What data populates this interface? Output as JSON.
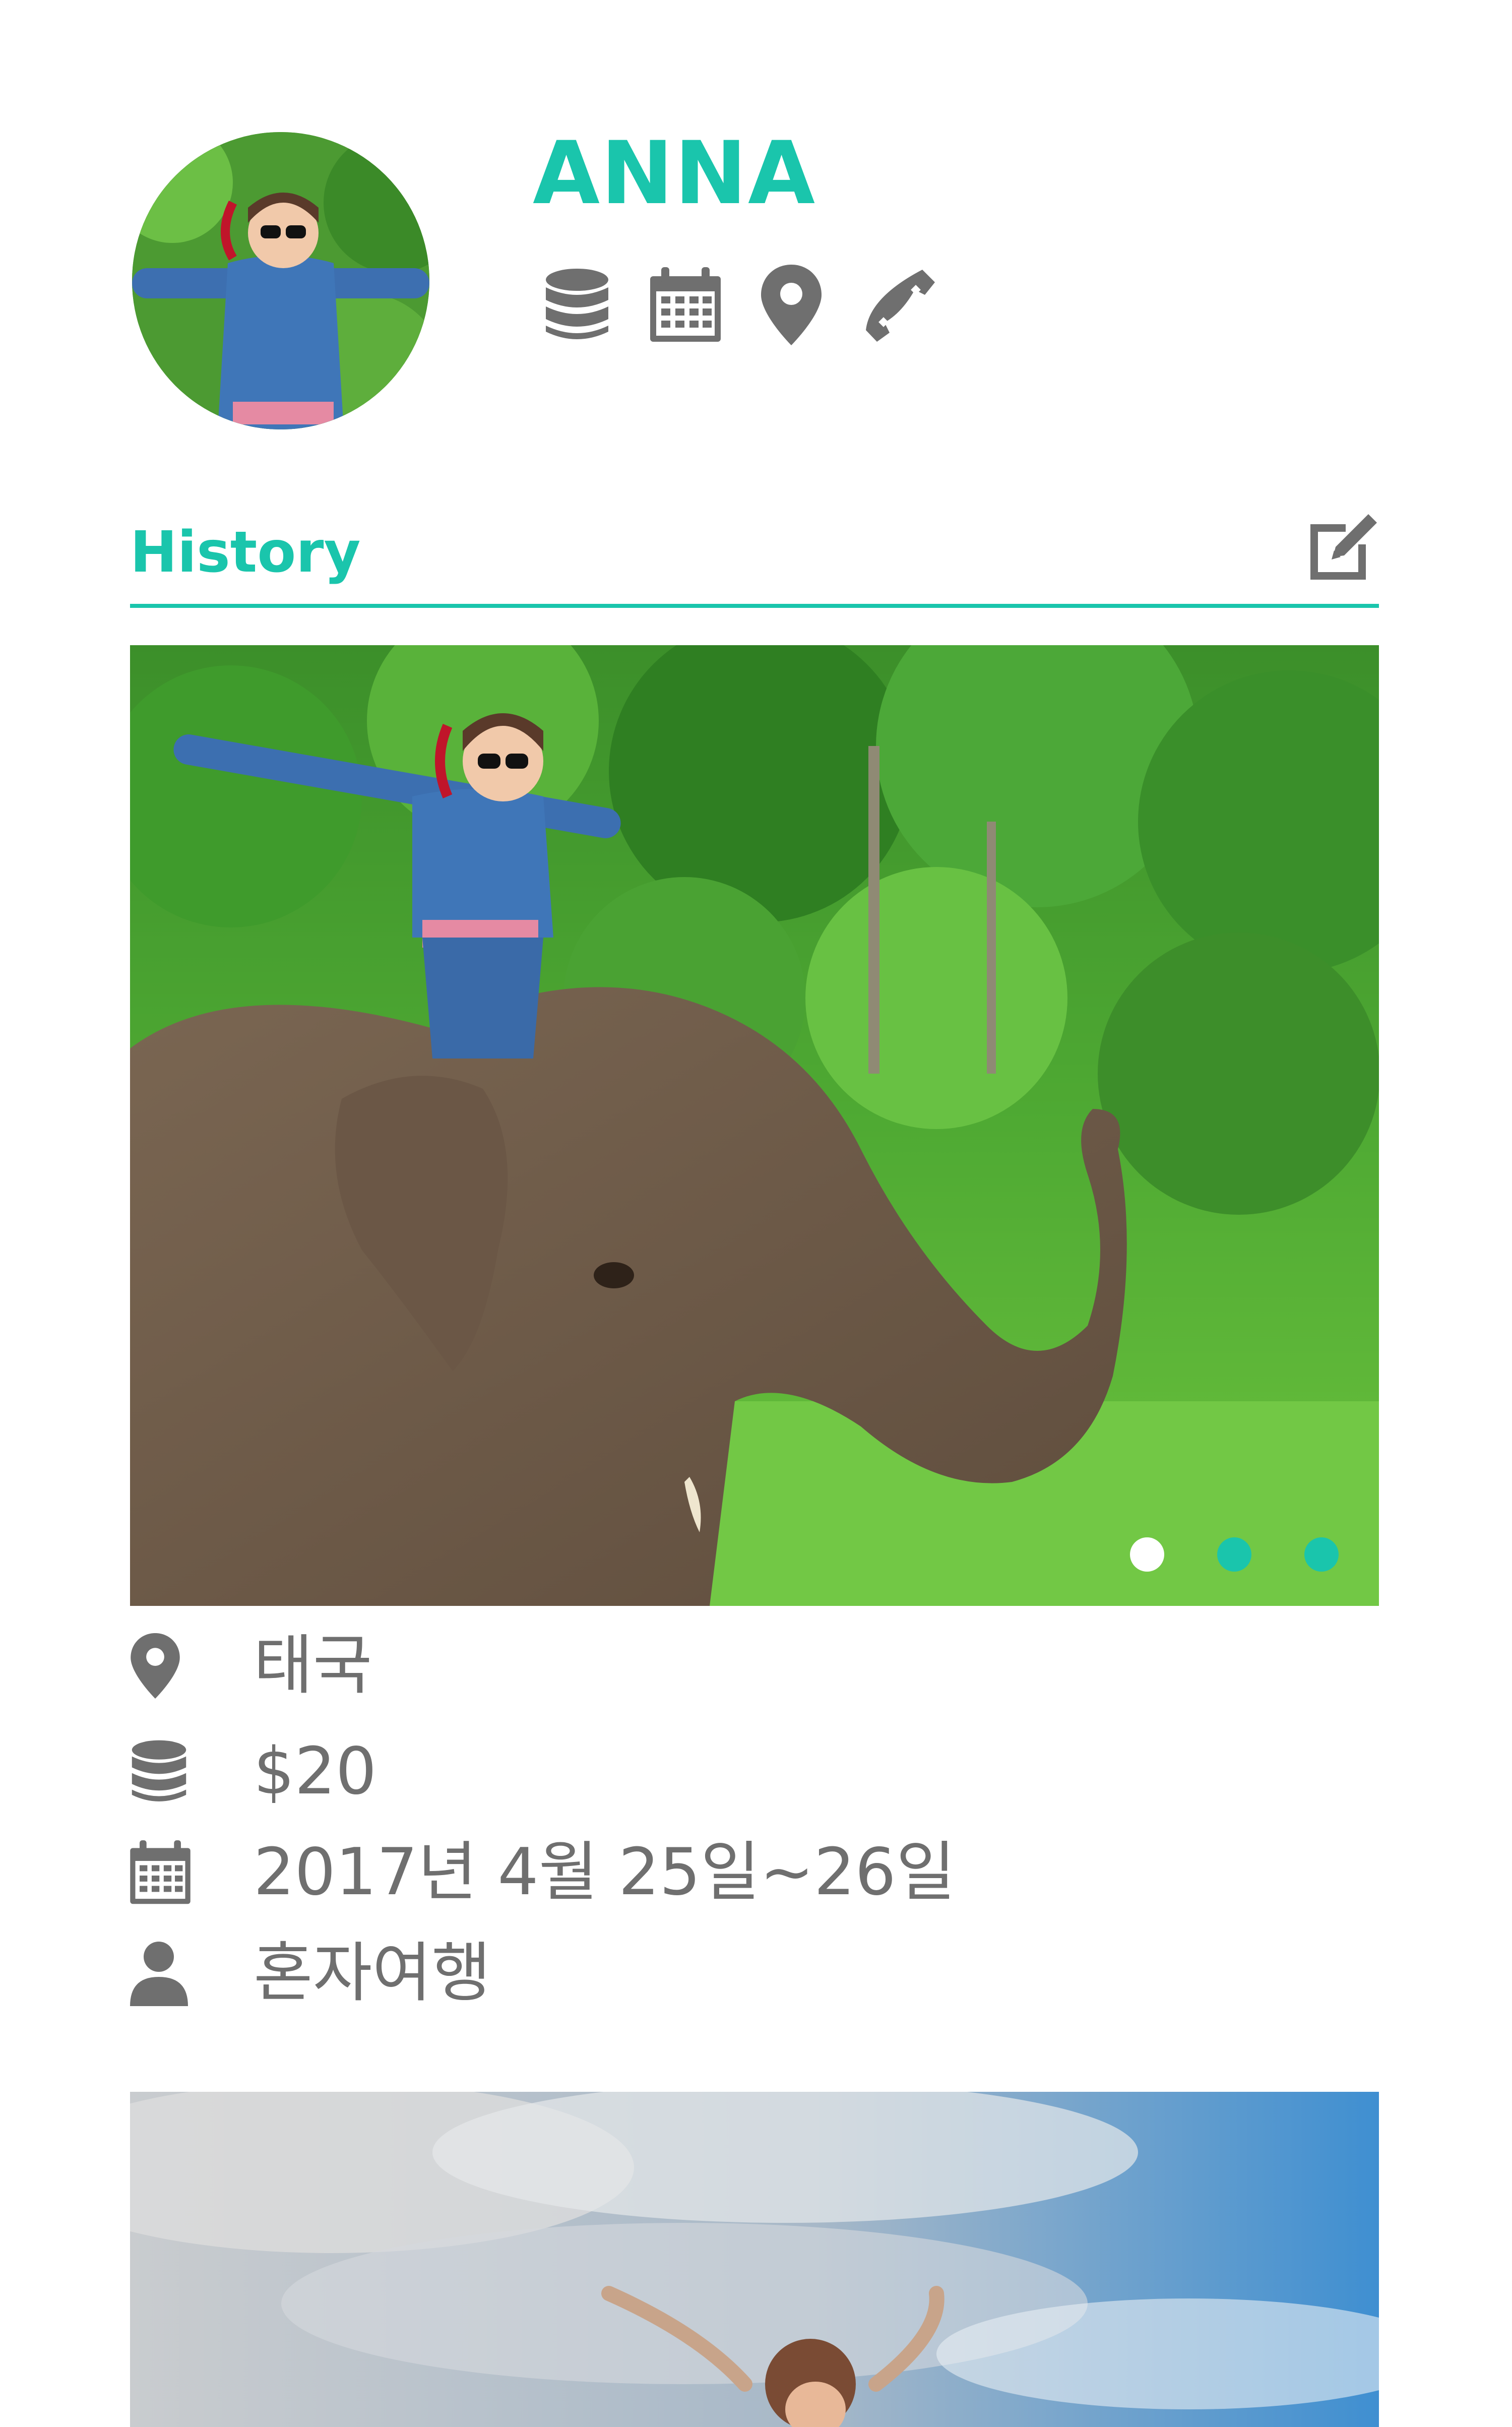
{
  "profile": {
    "name": "ANNA",
    "avatar_icon": "traveler-portrait-photo",
    "action_icons": [
      "coins-icon",
      "calendar-icon",
      "location-pin-icon",
      "phone-icon"
    ]
  },
  "history": {
    "title": "History",
    "edit_icon": "edit-icon",
    "accent_color": "#1ac5ac",
    "entries": [
      {
        "photo": "elephant-ride-photo",
        "carousel": {
          "count": 3,
          "active_index": 0
        },
        "location": "태국",
        "cost": "$20",
        "date": "2017년 4월 25일~26일",
        "companions": "혼자여행"
      },
      {
        "photo": "sky-jump-photo"
      }
    ]
  },
  "colors": {
    "icon_gray": "#6f6f6f",
    "dot_inactive": "#1ac5ac",
    "dot_active": "#ffffff"
  }
}
